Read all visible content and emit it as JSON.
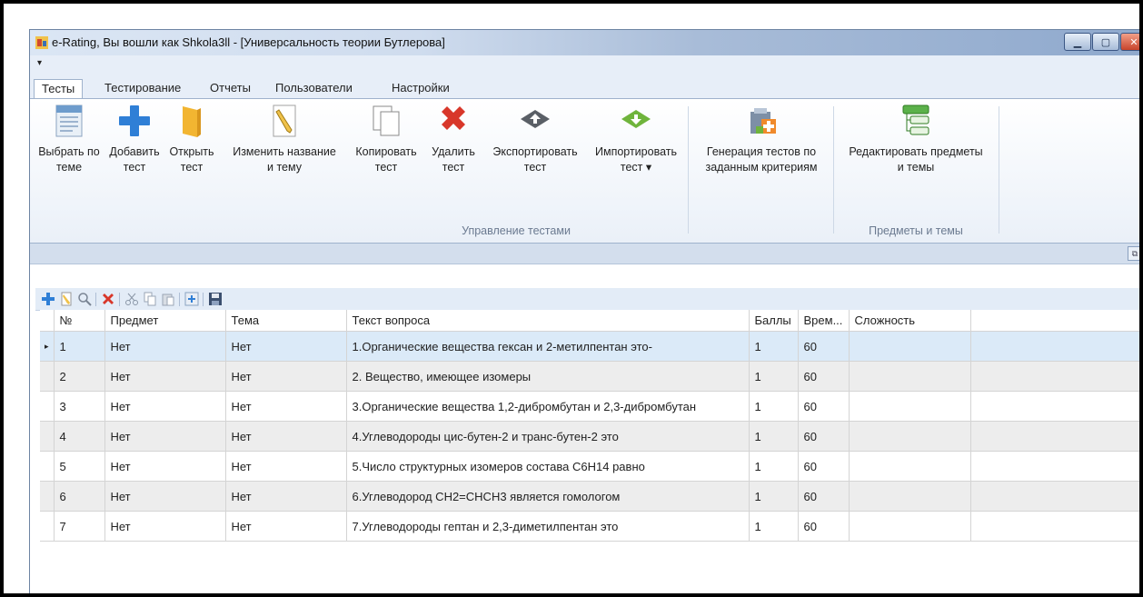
{
  "window": {
    "title": "e-Rating, Вы вошли как Shkola3ll - [Универсальность теории Бутлерова]"
  },
  "qat": {
    "toggle": "▾"
  },
  "tabs": [
    {
      "label": "Тесты",
      "active": true
    },
    {
      "label": "Тестирование"
    },
    {
      "label": "Отчеты"
    },
    {
      "label": "Пользователи"
    },
    {
      "label": "Настройки"
    }
  ],
  "ribbon": {
    "buttons": [
      {
        "line1": "Выбрать по",
        "line2": "теме",
        "icon": "document-list-icon"
      },
      {
        "line1": "Добавить",
        "line2": "тест",
        "icon": "plus-icon"
      },
      {
        "line1": "Открыть",
        "line2": "тест",
        "icon": "folder-icon"
      },
      {
        "line1": "Изменить название",
        "line2": "и тему",
        "icon": "pencil-document-icon"
      },
      {
        "line1": "Копировать",
        "line2": "тест",
        "icon": "copy-icon"
      },
      {
        "line1": "Удалить",
        "line2": "тест",
        "icon": "delete-x-icon"
      },
      {
        "line1": "Экспортировать",
        "line2": "тест",
        "icon": "export-icon"
      },
      {
        "line1": "Импортировать",
        "line2": "тест ▾",
        "icon": "import-icon"
      },
      {
        "line1": "Генерация тестов по",
        "line2": "заданным критериям",
        "icon": "generate-icon"
      },
      {
        "line1": "Редактировать предметы",
        "line2": "и темы",
        "icon": "tree-icon"
      }
    ],
    "groups": {
      "manage": "Управление тестами",
      "subjects": "Предметы и темы"
    }
  },
  "grid": {
    "columns": [
      "№",
      "Предмет",
      "Тема",
      "Текст вопроса",
      "Баллы",
      "Врем...",
      "Сложность"
    ],
    "selected_indicator": "▸",
    "rows": [
      {
        "n": "1",
        "subject": "Нет",
        "topic": "Нет",
        "text": "1.Органические вещества гексан и 2-метилпентан это-",
        "score": "1",
        "time": "60",
        "difficulty": ""
      },
      {
        "n": "2",
        "subject": "Нет",
        "topic": "Нет",
        "text": "2. Вещество, имеющее изомеры",
        "score": "1",
        "time": "60",
        "difficulty": ""
      },
      {
        "n": "3",
        "subject": "Нет",
        "topic": "Нет",
        "text": "3.Органические вещества 1,2-дибромбутан и 2,3-дибромбутан",
        "score": "1",
        "time": "60",
        "difficulty": ""
      },
      {
        "n": "4",
        "subject": "Нет",
        "topic": "Нет",
        "text": "4.Углеводороды цис-бутен-2 и транс-бутен-2 это",
        "score": "1",
        "time": "60",
        "difficulty": ""
      },
      {
        "n": "5",
        "subject": "Нет",
        "topic": "Нет",
        "text": "5.Число структурных изомеров состава С6Н14 равно",
        "score": "1",
        "time": "60",
        "difficulty": ""
      },
      {
        "n": "6",
        "subject": "Нет",
        "topic": "Нет",
        "text": "6.Углеводород СН2=СНСН3 является гомологом",
        "score": "1",
        "time": "60",
        "difficulty": ""
      },
      {
        "n": "7",
        "subject": "Нет",
        "topic": "Нет",
        "text": "7.Углеводороды гептан и 2,3-диметилпентан это",
        "score": "1",
        "time": "60",
        "difficulty": ""
      }
    ]
  },
  "colors": {
    "accent_blue": "#2f7fd6",
    "delete_red": "#d8372a",
    "folder_yellow": "#f2b531",
    "import_green": "#6fb43c"
  }
}
